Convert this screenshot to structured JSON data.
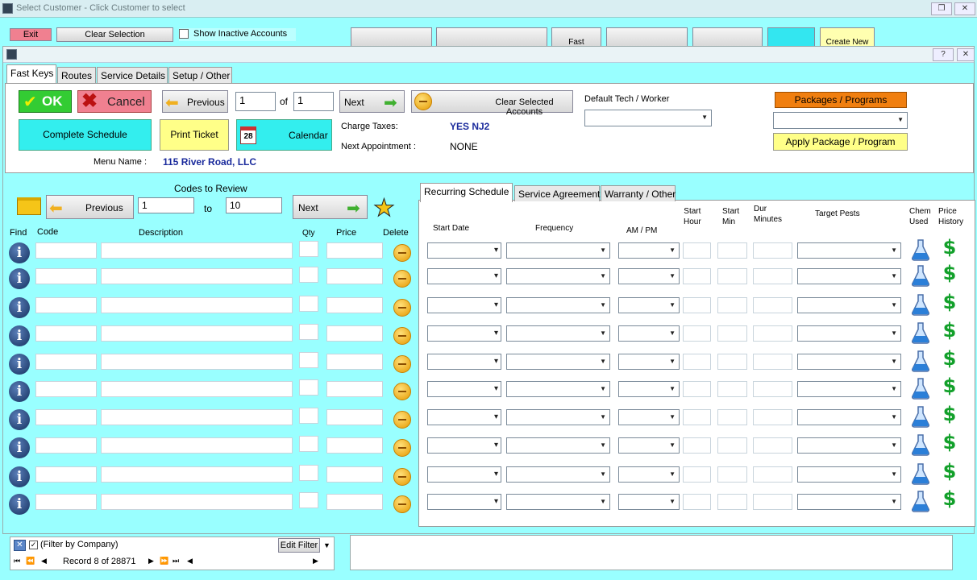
{
  "outer": {
    "title": "Select Customer - Click Customer to select",
    "exit": "Exit",
    "clear_selection": "Clear Selection",
    "show_inactive": "Show Inactive Accounts",
    "fast": "Fast",
    "create_new": "Create New"
  },
  "tabs": [
    "Fast Keys",
    "Routes",
    "Service Details",
    "Setup / Other"
  ],
  "top": {
    "ok": "OK",
    "cancel": "Cancel",
    "previous": "Previous",
    "page_value": "1",
    "of": "of",
    "page_total": "1",
    "next": "Next",
    "clear_selected": "Clear Selected Accounts",
    "default_tech": "Default Tech / Worker",
    "packages": "Packages / Programs",
    "apply_package": "Apply Package / Program",
    "complete_schedule": "Complete Schedule",
    "print_ticket": "Print Ticket",
    "calendar": "Calendar",
    "calendar_day": "28",
    "charge_taxes_label": "Charge Taxes:",
    "charge_taxes_value": "YES NJ2",
    "next_appt_label": "Next Appointment :",
    "next_appt_value": "NONE",
    "menu_name_label": "Menu Name :",
    "menu_name_value": "115 River Road, LLC"
  },
  "codes": {
    "codes_to_review": "Codes to Review",
    "previous": "Previous",
    "from": "1",
    "to": "to",
    "to_value": "10",
    "next": "Next",
    "headers": {
      "find": "Find",
      "code": "Code",
      "description": "Description",
      "qty": "Qty",
      "price": "Price",
      "delete": "Delete"
    }
  },
  "schedule": {
    "tabs": [
      "Recurring Schedule",
      "Service Agreement",
      "Warranty / Other"
    ],
    "headers": {
      "start_date": "Start Date",
      "frequency": "Frequency",
      "ampm": "AM / PM",
      "start_hour": "Start\nHour",
      "start_min": "Start\nMin",
      "dur_minutes": "Dur\nMinutes",
      "target_pests": "Target Pests",
      "chem_used": "Chem\nUsed",
      "price_history": "Price\nHistory"
    },
    "dollar": "$"
  },
  "nav": {
    "filter": "(Filter by Company)",
    "edit_filter": "Edit Filter",
    "record": "Record 8 of 28871"
  },
  "colors": {
    "cyan": "#99ffff",
    "ok_green": "#33cc33",
    "cancel_pink": "#f08090",
    "yellow": "#ffff88",
    "orange": "#f07f10",
    "blue_text": "#1a2a9c"
  }
}
